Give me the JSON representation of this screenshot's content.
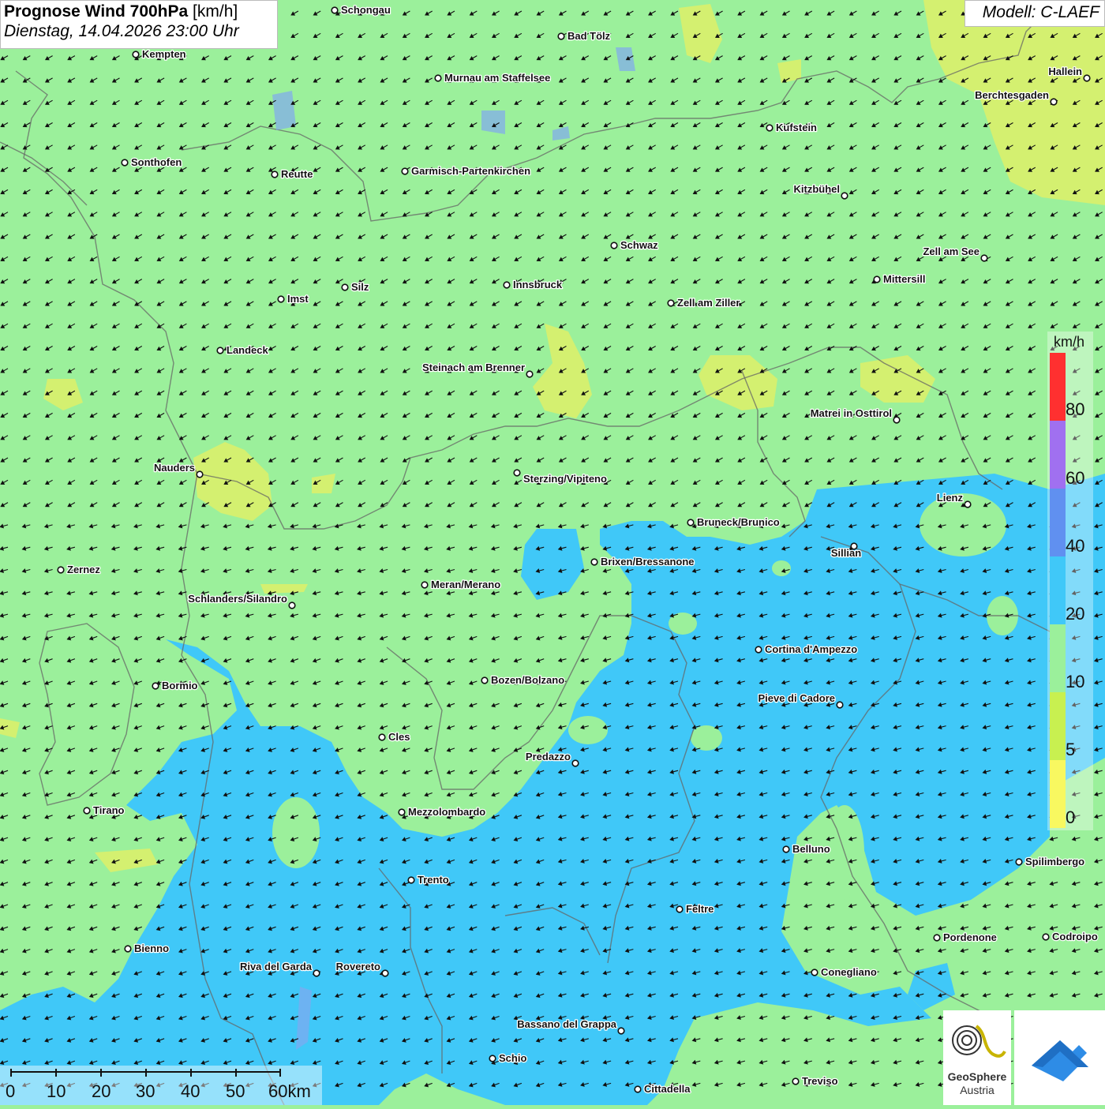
{
  "header": {
    "title_bold": "Prognose Wind 700hPa",
    "title_unit": "[km/h]",
    "datetime": "Dienstag, 14.04.2026 23:00 Uhr",
    "model": "Modell: C-LAEF"
  },
  "cities": [
    {
      "name": "Schongau"
    },
    {
      "name": "Bad Tölz"
    },
    {
      "name": "Kempten"
    },
    {
      "name": "Murnau am Staffelsee"
    },
    {
      "name": "Hallein"
    },
    {
      "name": "Berchtesgaden"
    },
    {
      "name": "Kufstein"
    },
    {
      "name": "Sonthofen"
    },
    {
      "name": "Reutte"
    },
    {
      "name": "Garmisch-Partenkirchen"
    },
    {
      "name": "Kitzbühel"
    },
    {
      "name": "Schwaz"
    },
    {
      "name": "Zell am See"
    },
    {
      "name": "Mittersill"
    },
    {
      "name": "Innsbruck"
    },
    {
      "name": "Silz"
    },
    {
      "name": "Imst"
    },
    {
      "name": "Zell am Ziller"
    },
    {
      "name": "Landeck"
    },
    {
      "name": "Steinach am Brenner"
    },
    {
      "name": "Matrei in Osttirol"
    },
    {
      "name": "Nauders"
    },
    {
      "name": "Sterzing/Vipiteno"
    },
    {
      "name": "Lienz"
    },
    {
      "name": "Bruneck/Brunico"
    },
    {
      "name": "Sillian"
    },
    {
      "name": "Zernez"
    },
    {
      "name": "Brixen/Bressanone"
    },
    {
      "name": "Meran/Merano"
    },
    {
      "name": "Schlanders/Silandro"
    },
    {
      "name": "Cortina d'Ampezzo"
    },
    {
      "name": "Bormio"
    },
    {
      "name": "Bozen/Bolzano"
    },
    {
      "name": "Pieve di Cadore"
    },
    {
      "name": "Cles"
    },
    {
      "name": "Predazzo"
    },
    {
      "name": "Tirano"
    },
    {
      "name": "Mezzolombardo"
    },
    {
      "name": "Belluno"
    },
    {
      "name": "Spilimbergo"
    },
    {
      "name": "Trento"
    },
    {
      "name": "Feltre"
    },
    {
      "name": "Pordenone"
    },
    {
      "name": "Codroipo"
    },
    {
      "name": "Bienno"
    },
    {
      "name": "Riva del Garda"
    },
    {
      "name": "Rovereto"
    },
    {
      "name": "Conegliano"
    },
    {
      "name": "Bassano del Grappa"
    },
    {
      "name": "Schio"
    },
    {
      "name": "Treviso"
    },
    {
      "name": "Cittadella"
    }
  ],
  "legend": {
    "unit": "km/h",
    "ticks": [
      "80",
      "60",
      "40",
      "20",
      "10",
      "5",
      "0"
    ],
    "colors": [
      "#ff3030",
      "#a070f0",
      "#6090f0",
      "#40c8f8",
      "#9bf09b",
      "#c8f050",
      "#f8f860"
    ]
  },
  "scalebar": {
    "labels": [
      "0",
      "10",
      "20",
      "30",
      "40",
      "50",
      "60km"
    ]
  },
  "logo": {
    "line1": "GeoSphere",
    "line2": "Austria"
  },
  "colors": {
    "calm_green": "#9bf09b",
    "light_blue": "#40c8f8",
    "yellow_green": "#d4f070"
  }
}
